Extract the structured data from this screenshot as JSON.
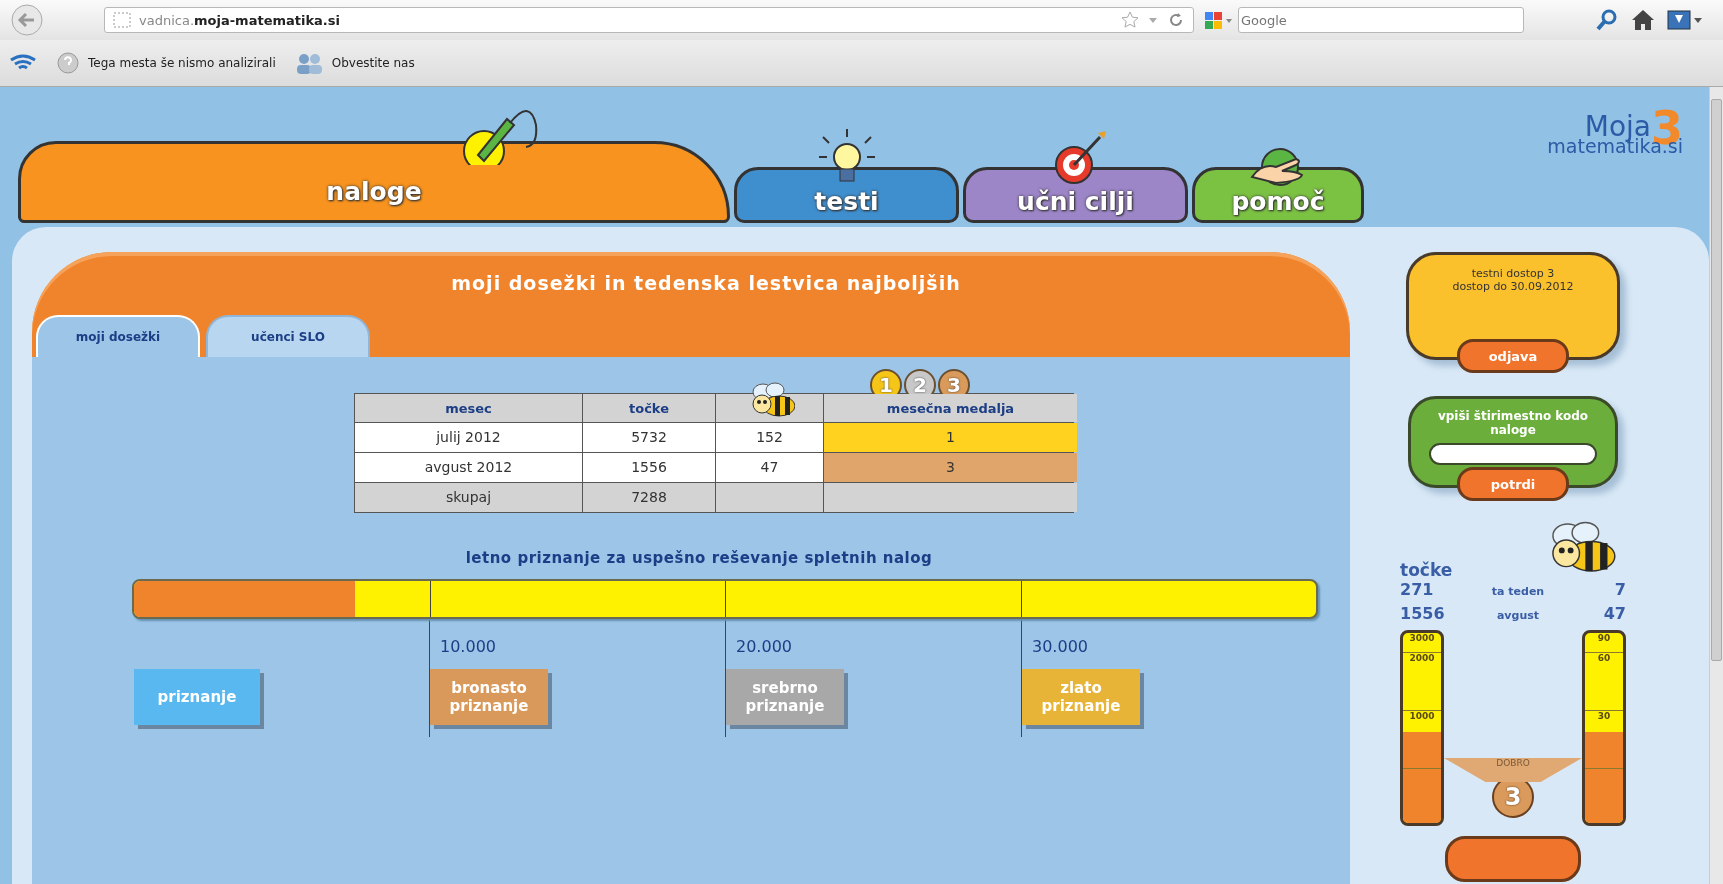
{
  "browser": {
    "url": "vadnica.**moja-matematika.si**",
    "search_placeholder": "Google",
    "toolbar": [
      {
        "label": "Tega mesta še nismo analizirali"
      },
      {
        "label": "Obvestite nas"
      }
    ]
  },
  "nav_tabs": [
    {
      "label": "naloge",
      "color": "#f7931e",
      "selected": true,
      "kind": "pencil"
    },
    {
      "label": "testi",
      "color": "#3f8fcf",
      "selected": false,
      "kind": "bulb"
    },
    {
      "label": "učni cilji",
      "color": "#9d86c8",
      "selected": false,
      "kind": "target"
    },
    {
      "label": "pomoč",
      "color": "#7cc242",
      "selected": false,
      "kind": "hand"
    }
  ],
  "logo": {
    "word": "Moja",
    "number": "3",
    "domain": "matematika.si"
  },
  "panel": {
    "title": "moji dosežki in tedenska lestvica najboljših",
    "tabs": [
      {
        "label": "moji dosežki",
        "selected": true
      },
      {
        "label": "učenci SLO",
        "selected": false
      }
    ]
  },
  "medals": [
    {
      "label": "1",
      "color": "#f5c518"
    },
    {
      "label": "2",
      "color": "#c8c8c8"
    },
    {
      "label": "3",
      "color": "#d99a5b"
    }
  ],
  "table": {
    "columns": [
      {
        "kind": "text",
        "label": "mesec"
      },
      {
        "kind": "text",
        "label": "točke"
      },
      {
        "kind": "bee"
      },
      {
        "kind": "text",
        "label": "mesečna medalja"
      }
    ],
    "rows": [
      {
        "kind": "month",
        "cells": [
          "julij 2012",
          "5732",
          "152",
          "1"
        ],
        "color": "#ffd21f"
      },
      {
        "kind": "month",
        "cells": [
          "avgust 2012",
          "1556",
          "47",
          "3"
        ],
        "color": "#dfa56a"
      },
      {
        "kind": "total",
        "cells": [
          "skupaj",
          "7288"
        ]
      }
    ]
  },
  "award": {
    "title": "letno priznanje za uspešno reševanje spletnih nalog",
    "level": 0.187,
    "milestones": [
      {
        "label": "priznanje",
        "color": "#5ab8f0"
      },
      {
        "value": "10.000",
        "label": "bronasto priznanje",
        "color": "#d9995a"
      },
      {
        "value": "20.000",
        "label": "srebrno priznanje",
        "color": "#a8a8a8"
      },
      {
        "value": "30.000",
        "label": "zlato priznanje",
        "color": "#e8b437"
      }
    ]
  },
  "sidebar": {
    "access": {
      "lines": [
        "testni dostop 3",
        "dostop do 30.09.2012"
      ],
      "button": "odjava"
    },
    "code": {
      "prompt": "vpiši štirimestno kodo naloge",
      "button": "potrdi"
    },
    "stats": {
      "title": "točke",
      "rows": [
        {
          "points": "271",
          "label": "ta teden",
          "bees": "7"
        },
        {
          "points": "1556",
          "label": "avgust",
          "bees": "47"
        }
      ]
    },
    "meters": [
      {
        "ticks": [
          "3000",
          "2000",
          "1000"
        ],
        "level": 0.48
      },
      {
        "ticks": [
          "90",
          "60",
          "30"
        ],
        "level": 0.48
      }
    ],
    "bridge": {
      "label": "DOBRO",
      "medal": "3"
    }
  }
}
